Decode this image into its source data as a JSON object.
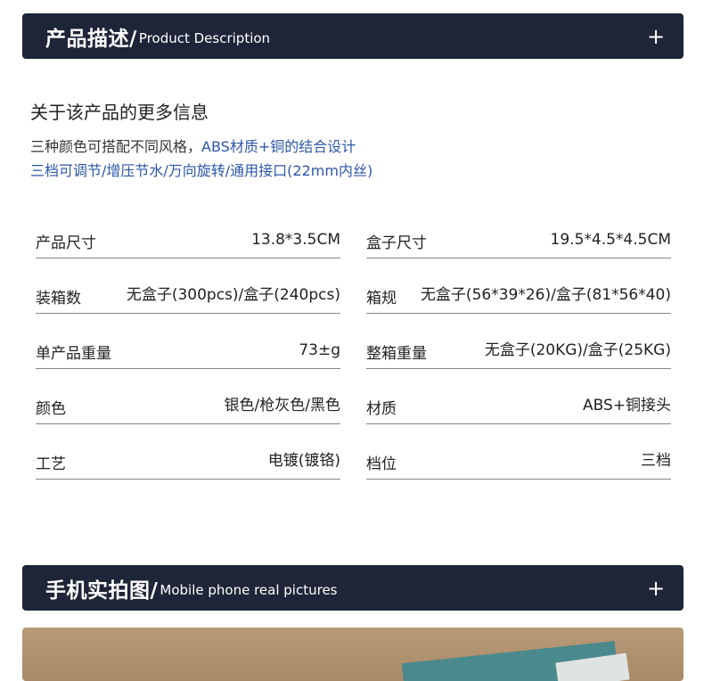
{
  "description_header": {
    "title_cn": "产品描述/",
    "title_en": "Product Description",
    "expand_symbol": "+"
  },
  "more_info": {
    "title": "关于该产品的更多信息",
    "line1_prefix": "三种颜色可搭配不同风格，",
    "line1_highlight": "ABS材质+铜的结合设计",
    "line2": "三档可调节/增压节水/万向旋转/通用接口(22mm内丝)"
  },
  "specs_left": [
    {
      "label": "产品尺寸",
      "value": "13.8*3.5CM"
    },
    {
      "label": "装箱数",
      "value": "无盒子(300pcs)/盒子(240pcs)"
    },
    {
      "label": "单产品重量",
      "value": "73±g"
    },
    {
      "label": "颜色",
      "value": "银色/枪灰色/黑色"
    },
    {
      "label": "工艺",
      "value": "电镀(镀铬)"
    }
  ],
  "specs_right": [
    {
      "label": "盒子尺寸",
      "value": "19.5*4.5*4.5CM"
    },
    {
      "label": "箱规",
      "value": "无盒子(56*39*26)/盒子(81*56*40)"
    },
    {
      "label": "整箱重量",
      "value": "无盒子(20KG)/盒子(25KG)"
    },
    {
      "label": "材质",
      "value": "ABS+铜接头"
    },
    {
      "label": "档位",
      "value": "三档"
    }
  ],
  "photos_header": {
    "title_cn": "手机实拍图/",
    "title_en": "Mobile phone real pictures",
    "expand_symbol": "+"
  },
  "colors": {
    "header_bg": "#1f2538",
    "highlight_text": "#2d56a8"
  }
}
